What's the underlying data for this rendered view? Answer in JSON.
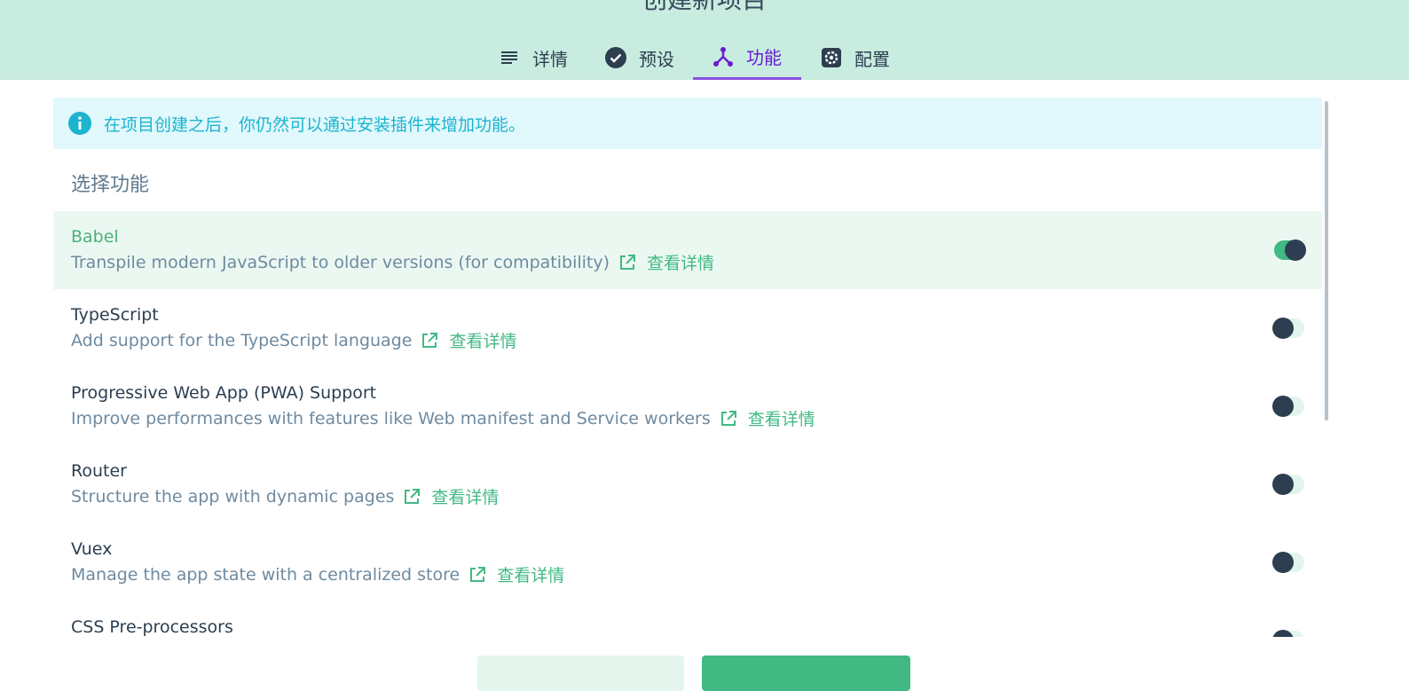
{
  "header": {
    "title": "创建新项目"
  },
  "tabs": [
    {
      "label": "详情",
      "icon": "list-icon"
    },
    {
      "label": "预设",
      "icon": "check-circle-icon"
    },
    {
      "label": "功能",
      "icon": "fork-icon",
      "active": true
    },
    {
      "label": "配置",
      "icon": "gear-icon"
    }
  ],
  "info": {
    "text": "在项目创建之后，你仍然可以通过安装插件来增加功能。",
    "icon": "info-icon"
  },
  "section_title": "选择功能",
  "features": [
    {
      "name": "Babel",
      "description": "Transpile modern JavaScript to older versions (for compatibility)",
      "link": "查看详情",
      "enabled": true
    },
    {
      "name": "TypeScript",
      "description": "Add support for the TypeScript language",
      "link": "查看详情",
      "enabled": false
    },
    {
      "name": "Progressive Web App (PWA) Support",
      "description": "Improve performances with features like Web manifest and Service workers",
      "link": "查看详情",
      "enabled": false
    },
    {
      "name": "Router",
      "description": "Structure the app with dynamic pages",
      "link": "查看详情",
      "enabled": false
    },
    {
      "name": "Vuex",
      "description": "Manage the app state with a centralized store",
      "link": "查看详情",
      "enabled": false
    },
    {
      "name": "CSS Pre-processors",
      "description": "",
      "link": "",
      "enabled": false
    }
  ],
  "colors": {
    "accent": "#42b983",
    "active_tab": "#6a1bd6",
    "header_bg": "#c8ecdf",
    "info_text": "#1cb4cf"
  }
}
